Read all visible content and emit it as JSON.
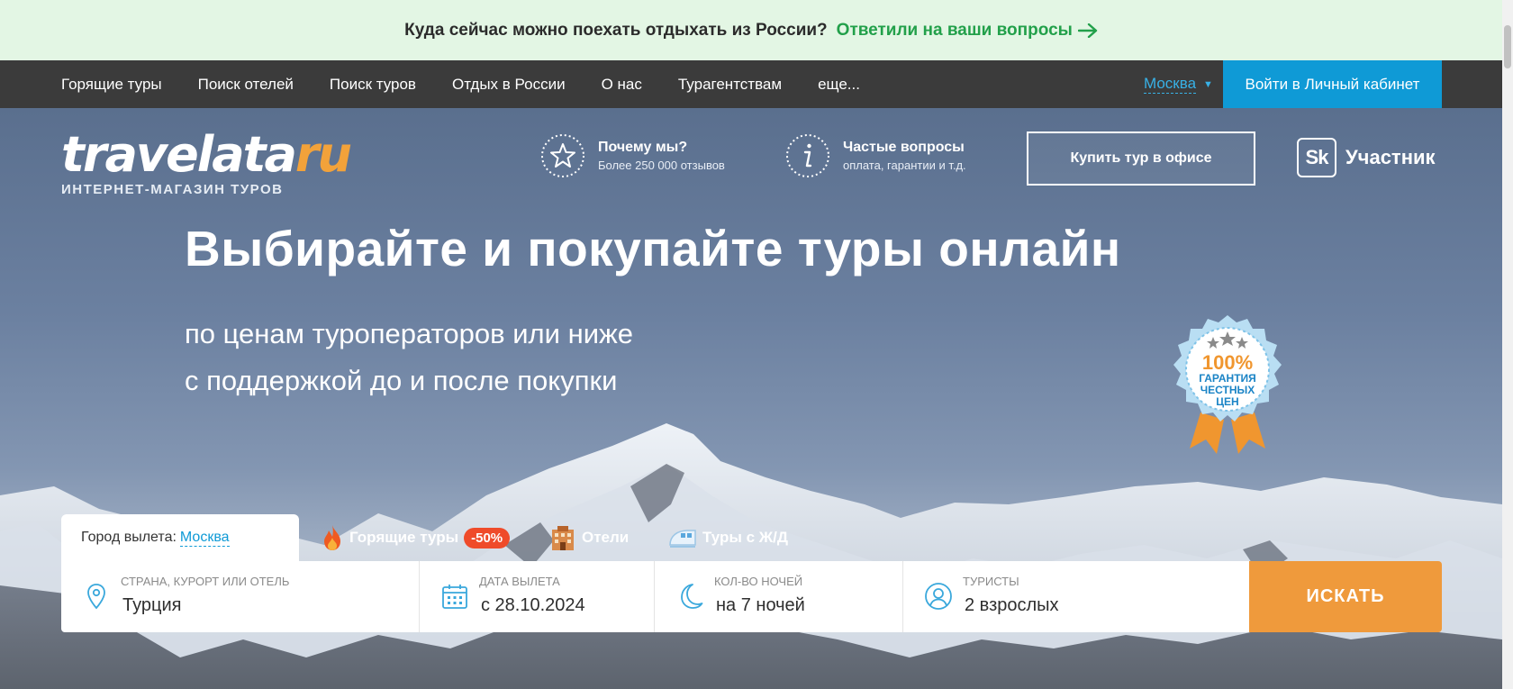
{
  "banner": {
    "text": "Куда сейчас можно поехать отдыхать из России?",
    "link": "Ответили на ваши вопросы"
  },
  "nav": {
    "items": [
      {
        "label": "Горящие туры"
      },
      {
        "label": "Поиск отелей"
      },
      {
        "label": "Поиск туров"
      },
      {
        "label": "Отдых в России"
      },
      {
        "label": "О нас"
      },
      {
        "label": "Турагентствам"
      },
      {
        "label": "еще..."
      }
    ],
    "city": "Москва",
    "login": "Войти в Личный кабинет"
  },
  "logo": {
    "word_main": "travelata",
    "word_ru": "ru",
    "tagline": "ИНТЕРНЕТ-МАГАЗИН ТУРОВ"
  },
  "features": [
    {
      "title": "Почему мы?",
      "subtitle": "Более 250 000 отзывов",
      "icon": "star-icon"
    },
    {
      "title": "Частые вопросы",
      "subtitle": "оплата, гарантии и т.д.",
      "icon": "info-icon"
    }
  ],
  "office_button": "Купить тур в офисе",
  "skolkovo": {
    "mark": "Sk",
    "label": "Участник"
  },
  "hero": {
    "headline": "Выбирайте и покупайте туры онлайн",
    "sub1": "по ценам туроператоров или ниже",
    "sub2": "с поддержкой до и после покупки"
  },
  "badge": {
    "percent": "100%",
    "line1": "ГАРАНТИЯ",
    "line2": "ЧЕСТНЫХ",
    "line3": "ЦЕН"
  },
  "search_tabs": {
    "city_label": "Город вылета:",
    "city_value": "Москва",
    "hot": "Горящие туры",
    "hot_discount": "-50%",
    "hotels": "Отели",
    "train": "Туры с Ж/Д"
  },
  "search_form": {
    "destination": {
      "label": "Страна, курорт или отель",
      "value": "Турция"
    },
    "date": {
      "label": "Дата вылета",
      "value": "с 28.10.2024"
    },
    "nights": {
      "label": "Кол-во ночей",
      "value": "на 7 ночей"
    },
    "tourists": {
      "label": "Туристы",
      "value": "2 взрослых"
    },
    "submit": "ИСКАТЬ"
  },
  "colors": {
    "accent_blue": "#0f9ad6",
    "accent_orange": "#ef9a3c",
    "banner_green": "#22a04a",
    "nav_bg": "#3b3b3b"
  }
}
